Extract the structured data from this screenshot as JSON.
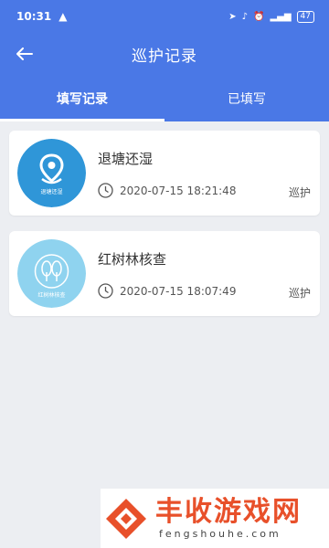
{
  "status_bar": {
    "time": "10:31",
    "battery": "47"
  },
  "appbar": {
    "title": "巡护记录",
    "back_icon": "arrow-left-icon"
  },
  "tabs": [
    {
      "label": "填写记录",
      "active": true
    },
    {
      "label": "已填写",
      "active": false
    }
  ],
  "records": [
    {
      "title": "退塘还湿",
      "time": "2020-07-15 18:21:48",
      "tag": "巡护",
      "thumb_text": "退塘还湿",
      "thumb_color": "#2f96d8"
    },
    {
      "title": "红树林核查",
      "time": "2020-07-15 18:07:49",
      "tag": "巡护",
      "thumb_text": "红树林核查",
      "thumb_color": "#8fd3ef"
    }
  ],
  "watermark": {
    "name": "丰收游戏网",
    "domain": "fengshouhe.com"
  },
  "colors": {
    "primary": "#4a78e6",
    "background": "#eceef2",
    "watermark": "#e8502a"
  }
}
